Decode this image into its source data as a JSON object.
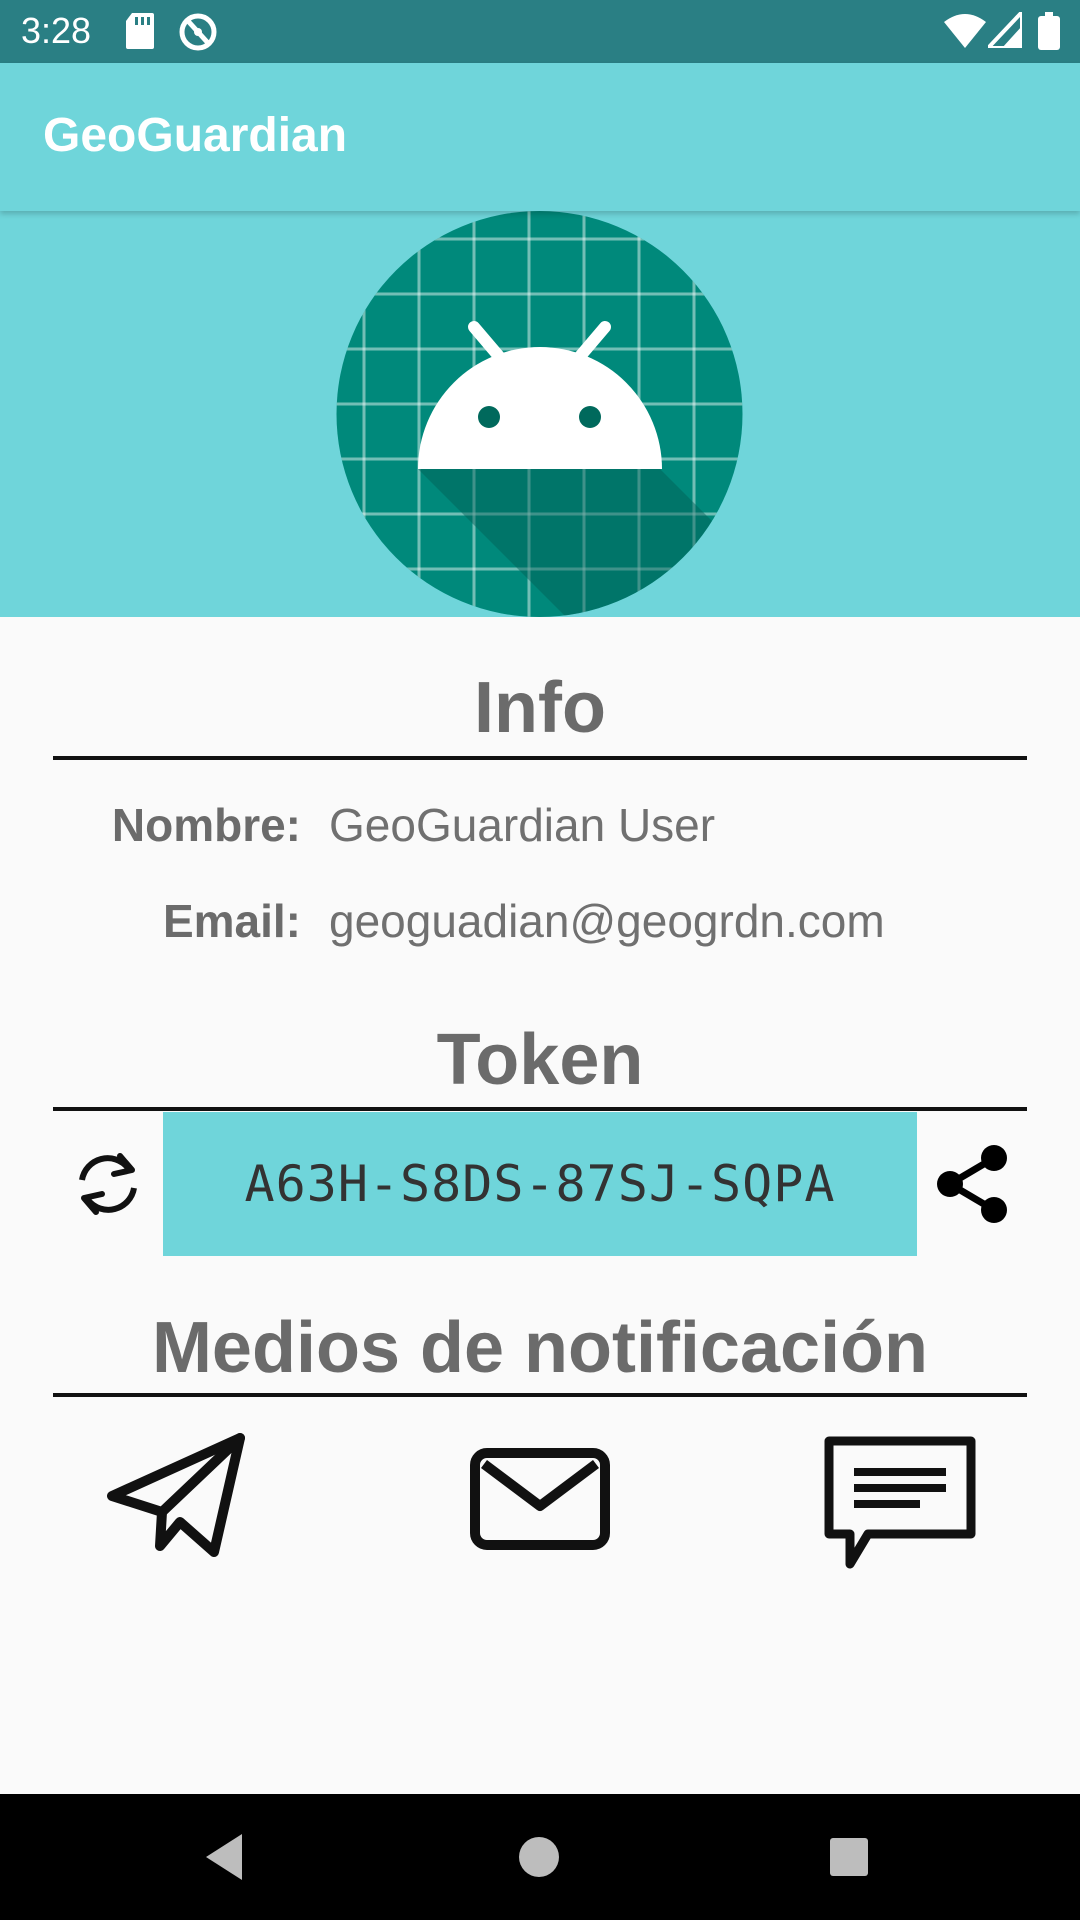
{
  "status_bar": {
    "time": "3:28",
    "icons": [
      "sd-card-icon",
      "sync-icon",
      "wifi-icon",
      "signal-icon",
      "battery-icon"
    ]
  },
  "app_bar": {
    "title": "GeoGuardian"
  },
  "profile": {
    "avatar_icon": "android-robot-icon"
  },
  "info": {
    "title": "Info",
    "name_label": "Nombre:",
    "name_value": "GeoGuardian User",
    "email_label": "Email:",
    "email_value": "geoguadian@geogrdn.com"
  },
  "token": {
    "title": "Token",
    "value": "A63H-S8DS-87SJ-SQPA",
    "refresh_icon": "refresh-icon",
    "share_icon": "share-icon"
  },
  "notifications": {
    "title": "Medios de notificación",
    "methods": [
      "telegram-icon",
      "email-icon",
      "sms-message-icon"
    ]
  },
  "nav_bar": {
    "buttons": [
      "back-icon",
      "home-icon",
      "recents-icon"
    ]
  },
  "colors": {
    "status_bar": "#2a7f84",
    "primary": "#6fd5da",
    "avatar_bg": "#00897b",
    "heading_text": "#6b6b6b",
    "background": "#fafafa"
  }
}
